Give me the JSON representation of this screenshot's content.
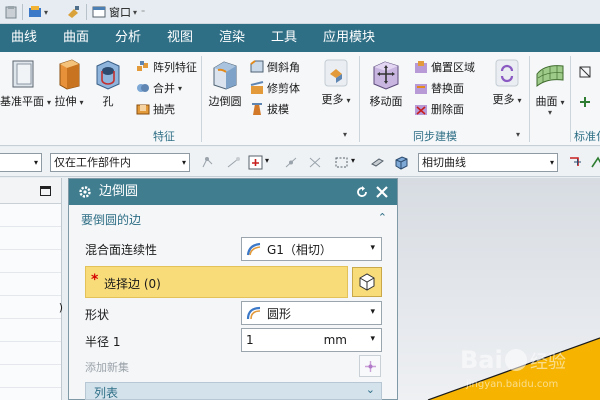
{
  "menu": {
    "tabs": [
      "曲线",
      "曲面",
      "分析",
      "视图",
      "渲染",
      "工具",
      "应用模块"
    ]
  },
  "quick_access": {
    "window_label": "窗口"
  },
  "ribbon": {
    "datum_plane": "基准平面",
    "extrude": "拉伸",
    "hole": "孔",
    "pattern_feature": "阵列特征",
    "unite": "合并",
    "shell": "抽壳",
    "edge_blend": "边倒圆",
    "chamfer": "倒斜角",
    "trim_body": "修剪体",
    "draft": "拔模",
    "more1": "更多",
    "feature_group": "特征",
    "move_face": "移动面",
    "offset_region": "偏置区域",
    "replace_face": "替换面",
    "delete_face": "删除面",
    "sync_group": "同步建模",
    "more2": "更多",
    "surface": "曲面",
    "standard_partial": "标准化"
  },
  "selection_bar": {
    "filter_value": "",
    "scope_value": "仅在工作部件内",
    "curve_rule_value": "相切曲线"
  },
  "dialog": {
    "title": "边倒圆",
    "section_edges": "要倒圆的边",
    "continuity_label": "混合面连续性",
    "continuity_value": "G1（相切）",
    "select_edge_star": "*",
    "select_edge_label": "选择边 (0)",
    "shape_label": "形状",
    "shape_value": "圆形",
    "radius_label": "半径 1",
    "radius_value": "1",
    "radius_unit": "mm",
    "add_new_set": "添加新集",
    "list_label": "列表"
  },
  "watermark": {
    "brand": "Bai",
    "brand2": "经验",
    "url": "jingyan.baidu.com"
  },
  "colors": {
    "menu_bar": "#2f6f86",
    "dialog_title": "#3f7d8f",
    "selection_highlight": "#f9dc7a",
    "accent_text": "#2f6f86",
    "required_star": "#d40000"
  }
}
